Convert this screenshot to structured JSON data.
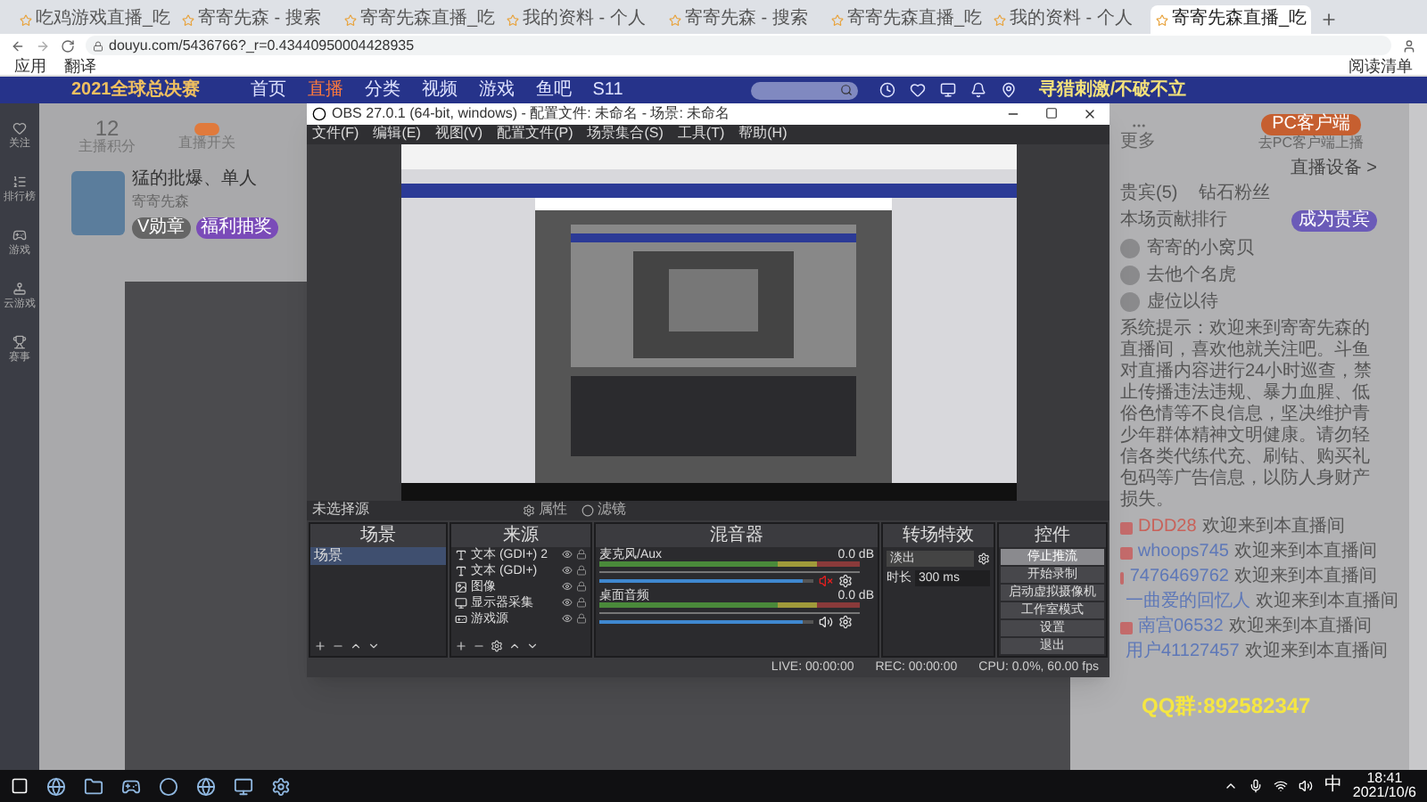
{
  "browser": {
    "tabs": [
      {
        "title": "吃鸡游戏直播_吃",
        "selected": false
      },
      {
        "title": "寄寄先森 - 搜索",
        "selected": false
      },
      {
        "title": "寄寄先森直播_吃",
        "selected": false
      },
      {
        "title": "我的资料 - 个人",
        "selected": false
      },
      {
        "title": "寄寄先森 - 搜索",
        "selected": false
      },
      {
        "title": "寄寄先森直播_吃",
        "selected": false
      },
      {
        "title": "我的资料 - 个人",
        "selected": false
      },
      {
        "title": "寄寄先森直播_吃",
        "selected": true
      }
    ],
    "address": "douyu.com/5436766?_r=0.43440950004428935",
    "bookmarks": [
      "应用",
      "翻译"
    ],
    "reading_list": "阅读清单"
  },
  "site_nav": {
    "logo": "2021全球总决赛",
    "items": [
      {
        "label": "首页",
        "selected": false
      },
      {
        "label": "直播",
        "selected": true
      },
      {
        "label": "分类",
        "selected": false
      },
      {
        "label": "视频",
        "selected": false
      },
      {
        "label": "游戏",
        "selected": false
      },
      {
        "label": "鱼吧",
        "selected": false
      },
      {
        "label": "S11",
        "selected": false
      }
    ],
    "banner": "寻猎刺激/不破不立"
  },
  "sidebar": [
    "关注",
    "排行榜",
    "游戏",
    "云游戏",
    "赛事"
  ],
  "room": {
    "score": "12",
    "score_label": "主播积分",
    "toggle_label": "直播开关",
    "title": "猛的批爆、单人",
    "tag": "寄寄先森",
    "badges": [
      "V勋章",
      "福利抽奖"
    ]
  },
  "obs": {
    "title": "OBS 27.0.1 (64-bit, windows) - 配置文件: 未命名 - 场景: 未命名",
    "menu": [
      "文件(F)",
      "编辑(E)",
      "视图(V)",
      "配置文件(P)",
      "场景集合(S)",
      "工具(T)",
      "帮助(H)"
    ],
    "source_bar": {
      "label": "未选择源",
      "buttons": [
        "属性",
        "滤镜"
      ]
    },
    "scenes": {
      "title": "场景",
      "items": [
        {
          "name": "场景",
          "selected": true
        }
      ]
    },
    "sources": {
      "title": "来源",
      "items": [
        {
          "name": "文本 (GDI+) 2",
          "kind": "text",
          "visible": true
        },
        {
          "name": "文本 (GDI+)",
          "kind": "text",
          "visible": true
        },
        {
          "name": "图像",
          "kind": "image",
          "visible": true
        },
        {
          "name": "显示器采集",
          "kind": "monitor",
          "visible": true
        },
        {
          "name": "游戏源",
          "kind": "game",
          "visible": true
        }
      ]
    },
    "mixer": {
      "title": "混音器",
      "channels": [
        {
          "name": "麦克风/Aux",
          "reading": "0.0 dB",
          "level": 0.95,
          "muted": true
        },
        {
          "name": "桌面音频",
          "reading": "0.0 dB",
          "level": 0.95,
          "muted": false
        }
      ]
    },
    "transitions": {
      "title": "转场特效",
      "value": "淡出",
      "duration_label": "时长",
      "duration": "300 ms"
    },
    "controls": {
      "title": "控件",
      "buttons": [
        {
          "label": "停止推流",
          "selected": true
        },
        {
          "label": "开始录制",
          "selected": false
        },
        {
          "label": "启动虚拟摄像机",
          "selected": false
        },
        {
          "label": "工作室模式",
          "selected": false
        },
        {
          "label": "设置",
          "selected": false
        },
        {
          "label": "退出",
          "selected": false
        }
      ]
    },
    "status": {
      "live": "LIVE: 00:00:00",
      "rec": "REC: 00:00:00",
      "cpu": "CPU: 0.0%, 60.00 fps"
    }
  },
  "chat": {
    "more_label": "更多",
    "client_button": "PC客户端",
    "client_caption": "去PC客户端上播",
    "device_link": "直播设备 >",
    "tabs": [
      "贵宾(5)",
      "钻石粉丝"
    ],
    "rank_title": "本场贡献排行",
    "rank_button": "成为贵宾",
    "rank": [
      "寄寄的小窝贝",
      "去他个名虎",
      "虚位以待"
    ],
    "notice": "系统提示：欢迎来到寄寄先森的直播间，喜欢他就关注吧。斗鱼对直播内容进行24小时巡查，禁止传播违法违规、暴力血腥、低俗色情等不良信息，坚决维护青少年群体精神文明健康。请勿轻信各类代练代充、刷钻、购买礼包码等广告信息，以防人身财产损失。",
    "messages": [
      {
        "user": "DDD28",
        "text": "欢迎来到本直播间",
        "color": "#c8625a"
      },
      {
        "user": "whoops745",
        "text": "欢迎来到本直播间",
        "color": "#5e78b8"
      },
      {
        "user": "7476469762",
        "text": "欢迎来到本直播间",
        "color": "#5e78b8"
      },
      {
        "user": "一曲爱的回忆人",
        "text": "欢迎来到本直播间",
        "color": "#5e78b8"
      },
      {
        "user": "南宫06532",
        "text": "欢迎来到本直播间",
        "color": "#5e78b8"
      },
      {
        "user": "用户41127457",
        "text": "欢迎来到本直播间",
        "color": "#5e78b8"
      }
    ],
    "overlay": "QQ群:892582347"
  },
  "taskbar": {
    "ime": "中",
    "time": "18:41",
    "date": "2021/10/6"
  }
}
